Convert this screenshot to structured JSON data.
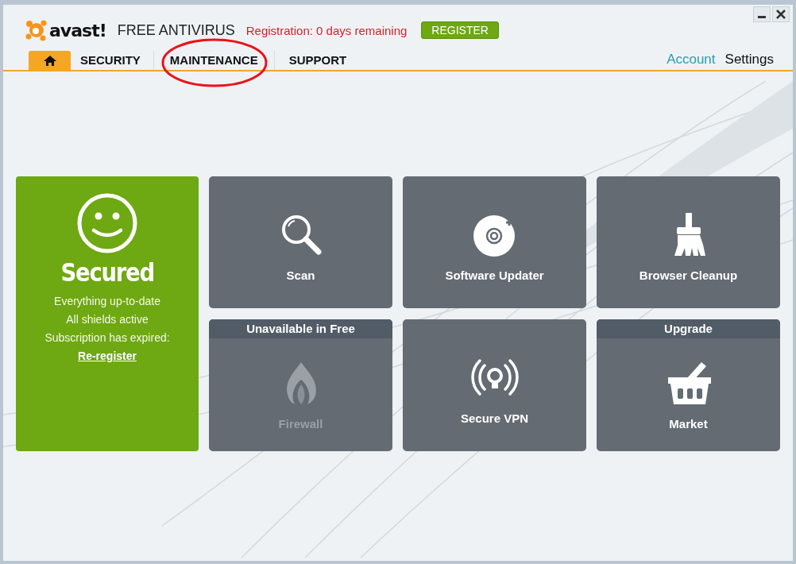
{
  "header": {
    "brand": "avast!",
    "product": "FREE ANTIVIRUS",
    "registration": "Registration: 0 days remaining",
    "register_button": "REGISTER"
  },
  "tabs": [
    {
      "kind": "home",
      "selected": true
    },
    {
      "kind": "text",
      "label": "SECURITY",
      "selected": false,
      "circled": false
    },
    {
      "kind": "text",
      "label": "MAINTENANCE",
      "selected": false,
      "circled": true
    },
    {
      "kind": "text",
      "label": "SUPPORT",
      "selected": false,
      "circled": false
    }
  ],
  "links": [
    {
      "label": "Account",
      "kind": "accent"
    },
    {
      "label": "Settings",
      "kind": "plain"
    }
  ],
  "status": {
    "title": "Secured",
    "lines": [
      "Everything up-to-date",
      "All shields active"
    ],
    "notice": "Subscription has expired:",
    "link": "Re-register"
  },
  "tiles": [
    {
      "label": "Scan",
      "kind": "scan",
      "disabled": false
    },
    {
      "label": "Software Updater",
      "kind": "updater",
      "disabled": false
    },
    {
      "label": "Browser Cleanup",
      "kind": "cleanup",
      "disabled": false
    },
    {
      "label": "Firewall",
      "kind": "firewall",
      "banner": "Unavailable in Free",
      "disabled": true
    },
    {
      "label": "Secure VPN",
      "kind": "vpn",
      "disabled": false
    },
    {
      "label": "Market",
      "kind": "market",
      "banner": "Upgrade",
      "disabled": false
    }
  ]
}
